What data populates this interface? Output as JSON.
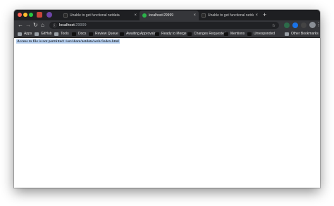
{
  "browser": {
    "tabs": [
      {
        "label": "Unable to get functional netdata",
        "active": false
      },
      {
        "label": "localhost:29999",
        "active": true
      },
      {
        "label": "Unable to get functional netdata",
        "active": false
      }
    ],
    "new_tab_label": "+",
    "tab_close_label": "×",
    "address": {
      "host": "localhost",
      "port": ":29999"
    },
    "bookmarks": [
      {
        "label": "Apps",
        "icon": "apps-grid-icon"
      },
      {
        "label": "GitHub",
        "icon": "folder-icon"
      },
      {
        "label": "Tools",
        "icon": "folder-icon"
      },
      {
        "label": "Docs",
        "icon": "github-icon"
      },
      {
        "label": "Review Queue",
        "icon": "github-icon"
      },
      {
        "label": "Awaiting Approvals",
        "icon": "github-icon"
      },
      {
        "label": "Ready to Merge",
        "icon": "github-icon"
      },
      {
        "label": "Changes Requested",
        "icon": "github-icon"
      },
      {
        "label": "Mentions",
        "icon": "github-icon"
      },
      {
        "label": "Unresponded",
        "icon": "github-icon"
      },
      {
        "label": "Other Bookmarks",
        "icon": "folder-icon"
      }
    ]
  },
  "page": {
    "message": "Access to file is not permitted: /usr/share/netdata/web//index.html"
  },
  "colors": {
    "titlebar": "#1e1f22",
    "toolbar": "#35363a",
    "selection": "#b3cdee",
    "active_tab_favicon": "#2bb34a"
  }
}
